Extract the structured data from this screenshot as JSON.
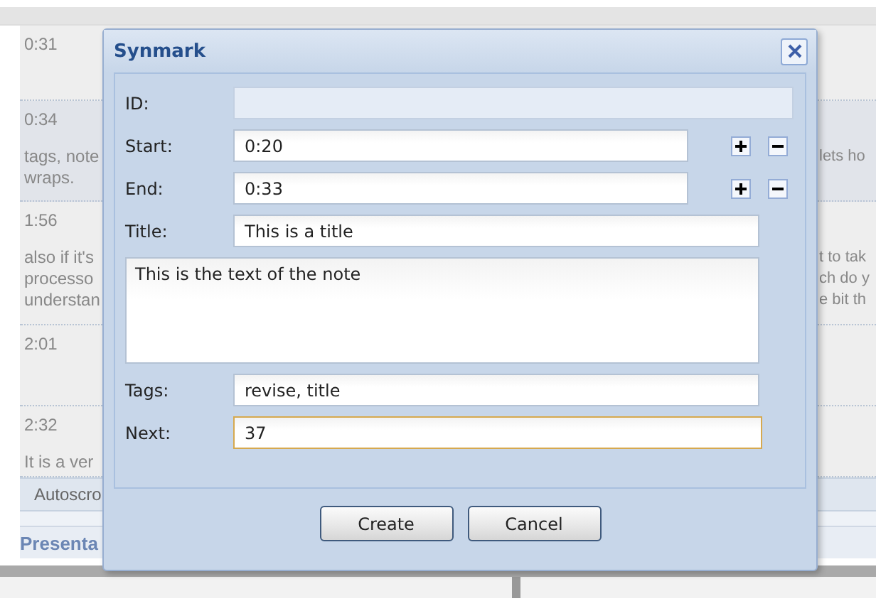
{
  "background": {
    "rows": [
      {
        "time": "0:31",
        "left_lines": [],
        "right_lines": [],
        "shaded": false
      },
      {
        "time": "0:34",
        "left_lines": [
          "tags, note",
          "wraps."
        ],
        "right_lines": [
          "lets ho"
        ],
        "shaded": true
      },
      {
        "time": "1:56",
        "left_lines": [
          "also if it's",
          "processo",
          "understan"
        ],
        "right_lines": [
          "t to tak",
          "ch do y",
          "e bit th"
        ],
        "shaded": false
      },
      {
        "time": "2:01",
        "left_lines": [],
        "right_lines": [],
        "shaded": false
      },
      {
        "time": "2:32",
        "left_lines": [
          "It is a ver"
        ],
        "right_lines": [],
        "shaded": false
      }
    ],
    "toolbar": {
      "label": "Autoscro"
    },
    "section_title": "Presenta"
  },
  "dialog": {
    "title": "Synmark",
    "fields": [
      {
        "label": "ID:",
        "kind": "text",
        "disabled": true,
        "focused": false
      },
      {
        "label": "Start:",
        "value": "0:20",
        "kind": "spin",
        "disabled": false,
        "focused": false
      },
      {
        "label": "End:",
        "value": "0:33",
        "kind": "spin",
        "disabled": false,
        "focused": false
      },
      {
        "label": "Title:",
        "value": "This is a title",
        "kind": "text",
        "disabled": false,
        "focused": false
      },
      {
        "value": "This is the text of the note",
        "kind": "note",
        "disabled": false,
        "focused": false
      },
      {
        "label": "Tags:",
        "value": "revise, title",
        "kind": "text",
        "disabled": false,
        "focused": false
      },
      {
        "label": "Next:",
        "value": "37",
        "kind": "text",
        "disabled": false,
        "focused": true
      }
    ],
    "buttons": [
      "Create",
      "Cancel"
    ]
  }
}
